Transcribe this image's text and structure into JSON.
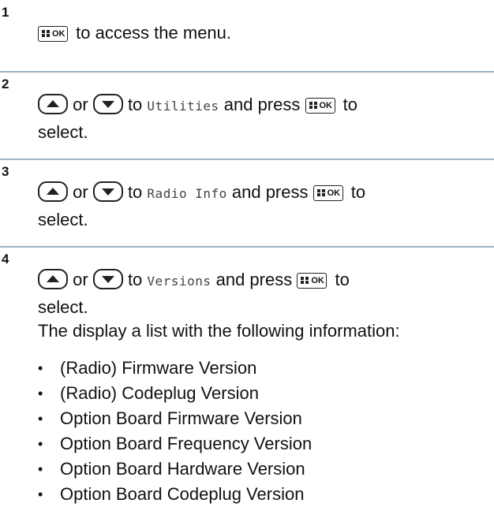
{
  "steps": [
    {
      "number": "1",
      "text": "to access the menu."
    },
    {
      "number": "2",
      "or": "or",
      "to": "to",
      "menu_item": "Utilities",
      "press": "and press",
      "to2": "to",
      "select": "select."
    },
    {
      "number": "3",
      "or": "or",
      "to": "to",
      "menu_item": "Radio Info",
      "press": "and press",
      "to2": "to",
      "select": "select."
    },
    {
      "number": "4",
      "or": "or",
      "to": "to",
      "menu_item": "Versions",
      "press": "and press",
      "to2": "to",
      "select": "select.",
      "description": "The display a list with the following information:",
      "items": [
        "(Radio) Firmware Version",
        "(Radio) Codeplug Version",
        "Option Board Firmware Version",
        "Option Board Frequency Version",
        "Option Board Hardware Version",
        "Option Board Codeplug Version"
      ]
    }
  ],
  "keys": {
    "ok_label": "OK",
    "menu_ok_icon": "menu-ok-key-icon",
    "up_icon": "up-arrow-key-icon",
    "down_icon": "down-arrow-key-icon"
  },
  "colors": {
    "separator": "#9eb3c2"
  }
}
